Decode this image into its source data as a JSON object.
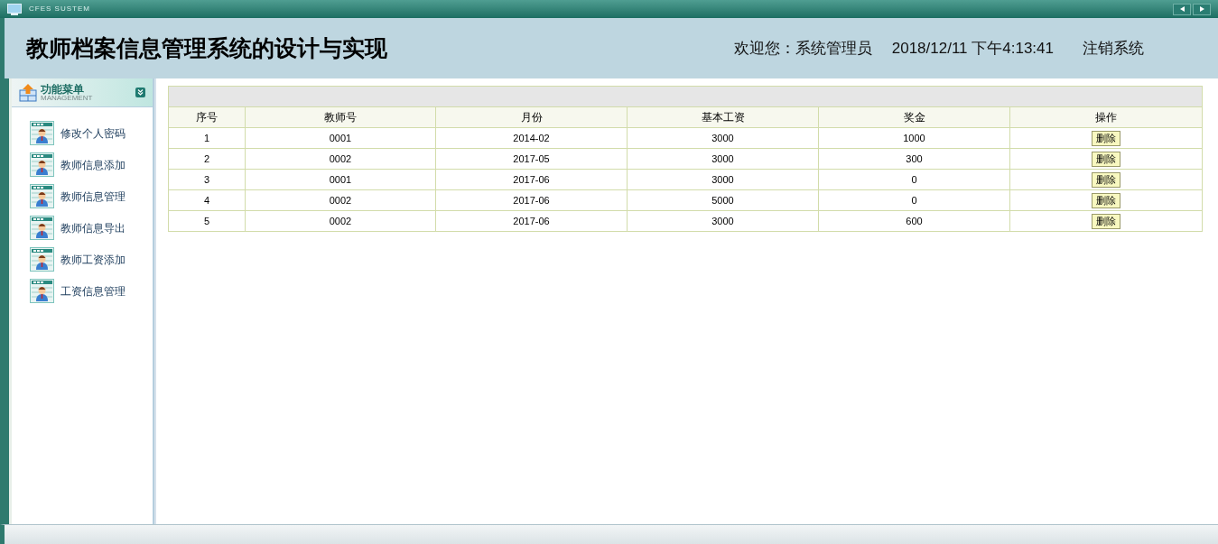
{
  "window": {
    "title": "CFES SUSTEM"
  },
  "header": {
    "title": "教师档案信息管理系统的设计与实现",
    "welcome": "欢迎您：系统管理员",
    "datetime": "2018/12/11 下午4:13:41",
    "logout": "注销系统"
  },
  "sidebar": {
    "title": "功能菜单",
    "subtitle": "MANAGEMENT",
    "items": [
      "修改个人密码",
      "教师信息添加",
      "教师信息管理",
      "教师信息导出",
      "教师工资添加",
      "工资信息管理"
    ]
  },
  "table": {
    "columns": [
      "序号",
      "教师号",
      "月份",
      "基本工资",
      "奖金",
      "操作"
    ],
    "rows": [
      {
        "cells": [
          "1",
          "0001",
          "2014-02",
          "3000",
          "1000"
        ],
        "action": "删除"
      },
      {
        "cells": [
          "2",
          "0002",
          "2017-05",
          "3000",
          "300"
        ],
        "action": "删除"
      },
      {
        "cells": [
          "3",
          "0001",
          "2017-06",
          "3000",
          "0"
        ],
        "action": "删除"
      },
      {
        "cells": [
          "4",
          "0002",
          "2017-06",
          "5000",
          "0"
        ],
        "action": "删除"
      },
      {
        "cells": [
          "5",
          "0002",
          "2017-06",
          "3000",
          "600"
        ],
        "action": "删除"
      }
    ]
  }
}
